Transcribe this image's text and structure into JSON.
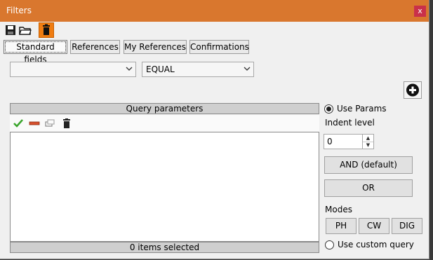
{
  "window": {
    "title": "Filters",
    "close_label": "x"
  },
  "toolbar": {
    "icons": [
      "save-icon",
      "open-folder-icon",
      "trash-icon"
    ],
    "highlight_color": "#f07d12"
  },
  "tabs": [
    "Standard fields",
    "References",
    "My References",
    "Confirmations"
  ],
  "filter": {
    "field_value": "",
    "operator_value": "EQUAL"
  },
  "query": {
    "header": "Query parameters",
    "toolbar_icons": [
      "check-icon",
      "remove-icon",
      "copy-icon",
      "trash-icon"
    ],
    "status": "0 items selected"
  },
  "options": {
    "use_params_label": "Use Params",
    "indent_label": "Indent level",
    "indent_value": "0",
    "and_button": "AND (default)",
    "or_button": "OR",
    "modes_label": "Modes",
    "mode_buttons": [
      "PH",
      "CW",
      "DIG"
    ],
    "custom_query_label": "Use custom query"
  },
  "colors": {
    "titlebar": "#d9772e",
    "close": "#c9304a"
  }
}
